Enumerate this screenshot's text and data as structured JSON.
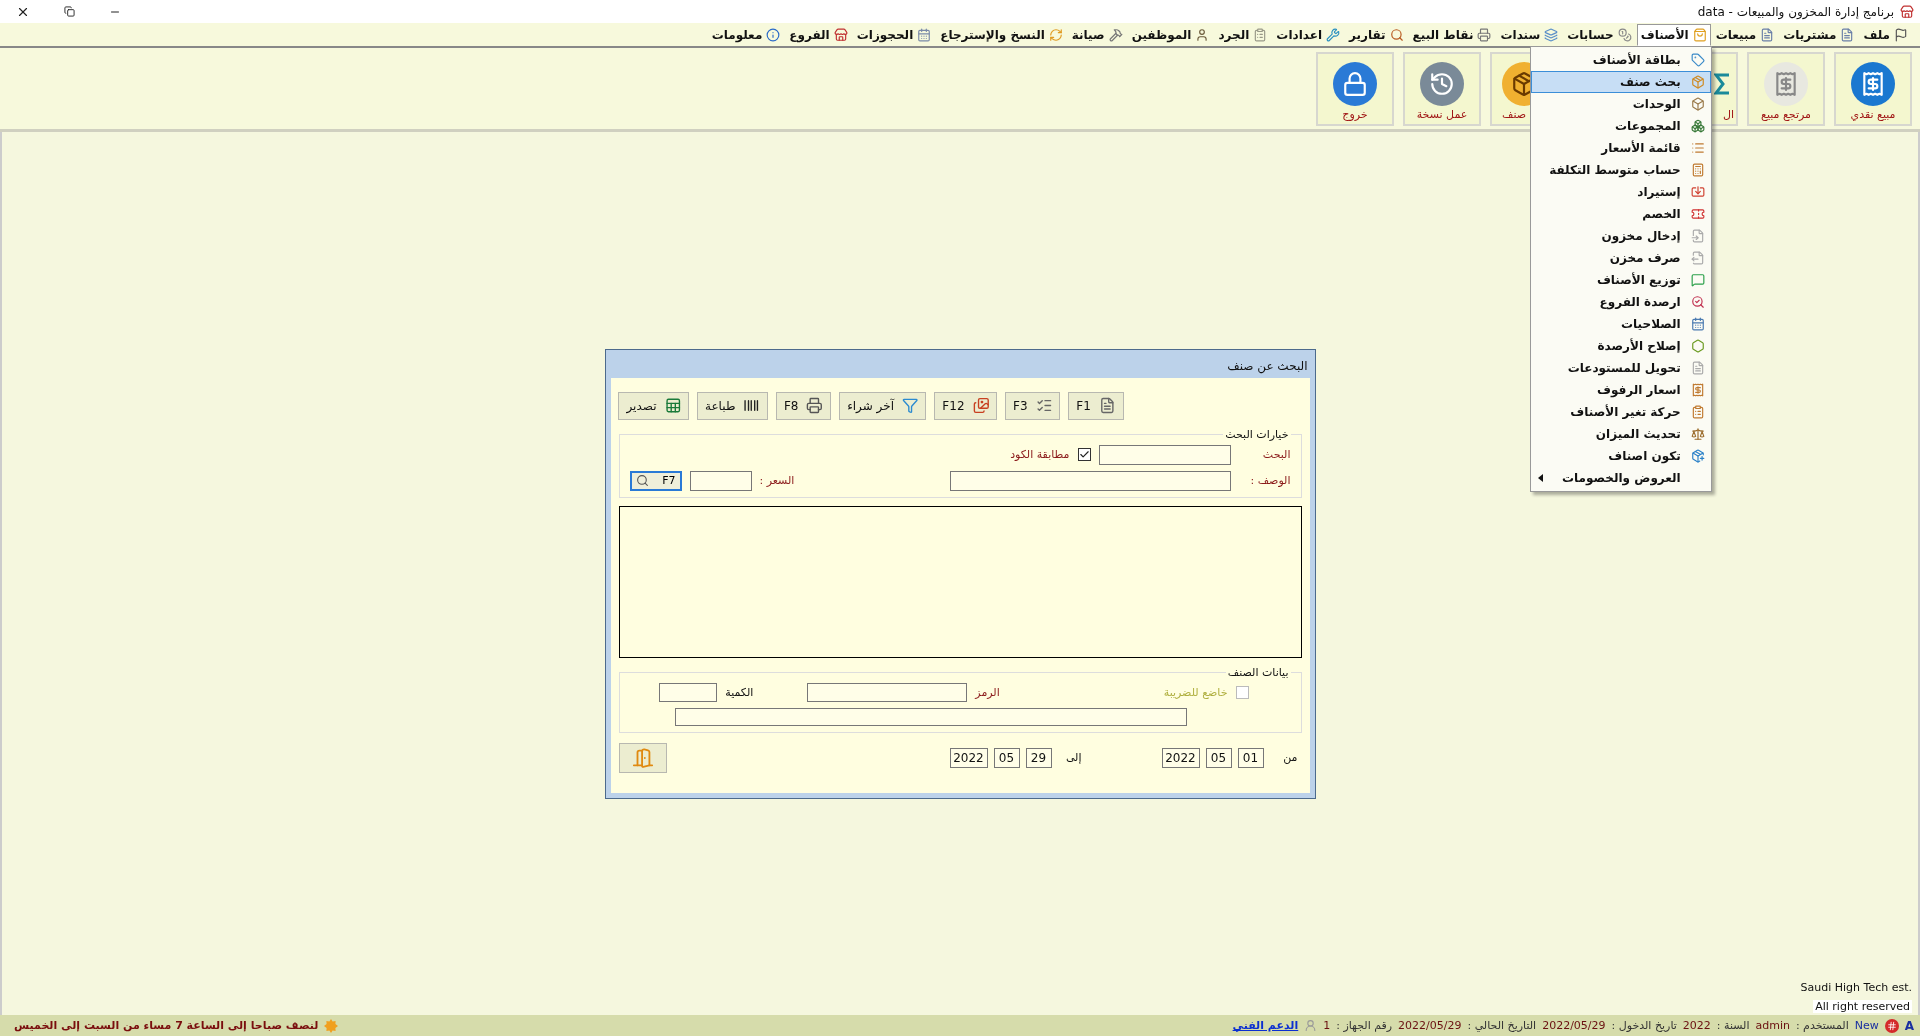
{
  "window": {
    "title": "برنامج إدارة المخزون والمبيعات - data"
  },
  "menu": [
    {
      "label": "ملف",
      "selected": false
    },
    {
      "label": "مشتريات",
      "selected": false
    },
    {
      "label": "مبيعات",
      "selected": false
    },
    {
      "label": "الأصناف",
      "selected": true
    },
    {
      "label": "حسابات",
      "selected": false
    },
    {
      "label": "سندات",
      "selected": false
    },
    {
      "label": "نقاط البيع",
      "selected": false
    },
    {
      "label": "تقارير",
      "selected": false
    },
    {
      "label": "اعدادات",
      "selected": false
    },
    {
      "label": "الجرد",
      "selected": false
    },
    {
      "label": "الموظفين",
      "selected": false
    },
    {
      "label": "صيانة",
      "selected": false
    },
    {
      "label": "النسخ والإسترجاع",
      "selected": false
    },
    {
      "label": "الحجوزات",
      "selected": false
    },
    {
      "label": "الفروع",
      "selected": false
    },
    {
      "label": "معلومات",
      "selected": false
    }
  ],
  "toolbar": [
    {
      "label": "مبيع نقدي"
    },
    {
      "label": "مرتجع مبيع"
    },
    {
      "label": "ال"
    },
    {
      "label": "صنف"
    },
    {
      "label": "عمل نسخة"
    },
    {
      "label": "خروج"
    }
  ],
  "dropdown": {
    "items": [
      {
        "label": "بطاقة الأصناف",
        "selected": false,
        "has_submenu": false
      },
      {
        "label": "بحث صنف",
        "selected": true,
        "has_submenu": false
      },
      {
        "label": "الوحدات",
        "selected": false,
        "has_submenu": false
      },
      {
        "label": "المجموعات",
        "selected": false,
        "has_submenu": false
      },
      {
        "label": "قائمة الأسعار",
        "selected": false,
        "has_submenu": false
      },
      {
        "label": "حساب متوسط التكلفة",
        "selected": false,
        "has_submenu": false
      },
      {
        "label": "إستيراد",
        "selected": false,
        "has_submenu": false
      },
      {
        "label": "الخصم",
        "selected": false,
        "has_submenu": false
      },
      {
        "label": "إدخال مخزون",
        "selected": false,
        "has_submenu": false
      },
      {
        "label": "صرف مخزن",
        "selected": false,
        "has_submenu": false
      },
      {
        "label": "توزيع الأصناف",
        "selected": false,
        "has_submenu": false
      },
      {
        "label": "ارصدة الفروع",
        "selected": false,
        "has_submenu": false
      },
      {
        "label": "الصلاحيات",
        "selected": false,
        "has_submenu": false
      },
      {
        "label": "إصلاح الأرصدة",
        "selected": false,
        "has_submenu": false
      },
      {
        "label": "تحويل للمستودعات",
        "selected": false,
        "has_submenu": false
      },
      {
        "label": "اسعار الرفوف",
        "selected": false,
        "has_submenu": false
      },
      {
        "label": "حركة تغير الأصناف",
        "selected": false,
        "has_submenu": false
      },
      {
        "label": "تحديث الميزان",
        "selected": false,
        "has_submenu": false
      },
      {
        "label": "تكون اصناف",
        "selected": false,
        "has_submenu": false
      },
      {
        "label": "العروض والخصومات",
        "selected": false,
        "has_submenu": true
      }
    ]
  },
  "dialog": {
    "title": "البحث عن صنف",
    "buttons": [
      {
        "label": "F1"
      },
      {
        "label": "F3"
      },
      {
        "label": "F12"
      },
      {
        "label": "آخر شراء"
      },
      {
        "label": "F8"
      },
      {
        "label": "طباعة"
      },
      {
        "label": "تصدير"
      }
    ],
    "search_options": {
      "legend": "خيارات البحث",
      "search_label": "البحث",
      "code_match": {
        "label": "مطابقة الكود",
        "checked": true
      },
      "description_label": "الوصف :",
      "price_label": "السعر :",
      "search_button": "F7"
    },
    "item_data": {
      "legend": "بيانات الصنف",
      "taxable": {
        "label": "خاضع للضريبة",
        "checked": false
      },
      "code_label": "الرمز",
      "quantity_label": "الكمية"
    },
    "date_range": {
      "from_label": "من",
      "from": {
        "day": "01",
        "month": "05",
        "year": "2022"
      },
      "to_label": "إلى",
      "to": {
        "day": "29",
        "month": "05",
        "year": "2022"
      }
    }
  },
  "copyright": {
    "company": "Saudi High Tech est.",
    "rights": "All right reserved"
  },
  "status_bar": {
    "mode_letter": "A",
    "new_label": "New",
    "fields": [
      {
        "label": "المستخدم :",
        "value": "admin"
      },
      {
        "label": "السنة :",
        "value": "2022"
      },
      {
        "label": "تاريخ الدخول :",
        "value": "2022/05/29"
      },
      {
        "label": "التاريخ الحالي :",
        "value": "2022/05/29"
      },
      {
        "label": "رقم الجهاز :",
        "value": "1"
      }
    ],
    "support_link": "الدعم الفني",
    "notice": "لنصف صباحا إلى الساعة 7 مساء من السبت إلى الخميس"
  }
}
